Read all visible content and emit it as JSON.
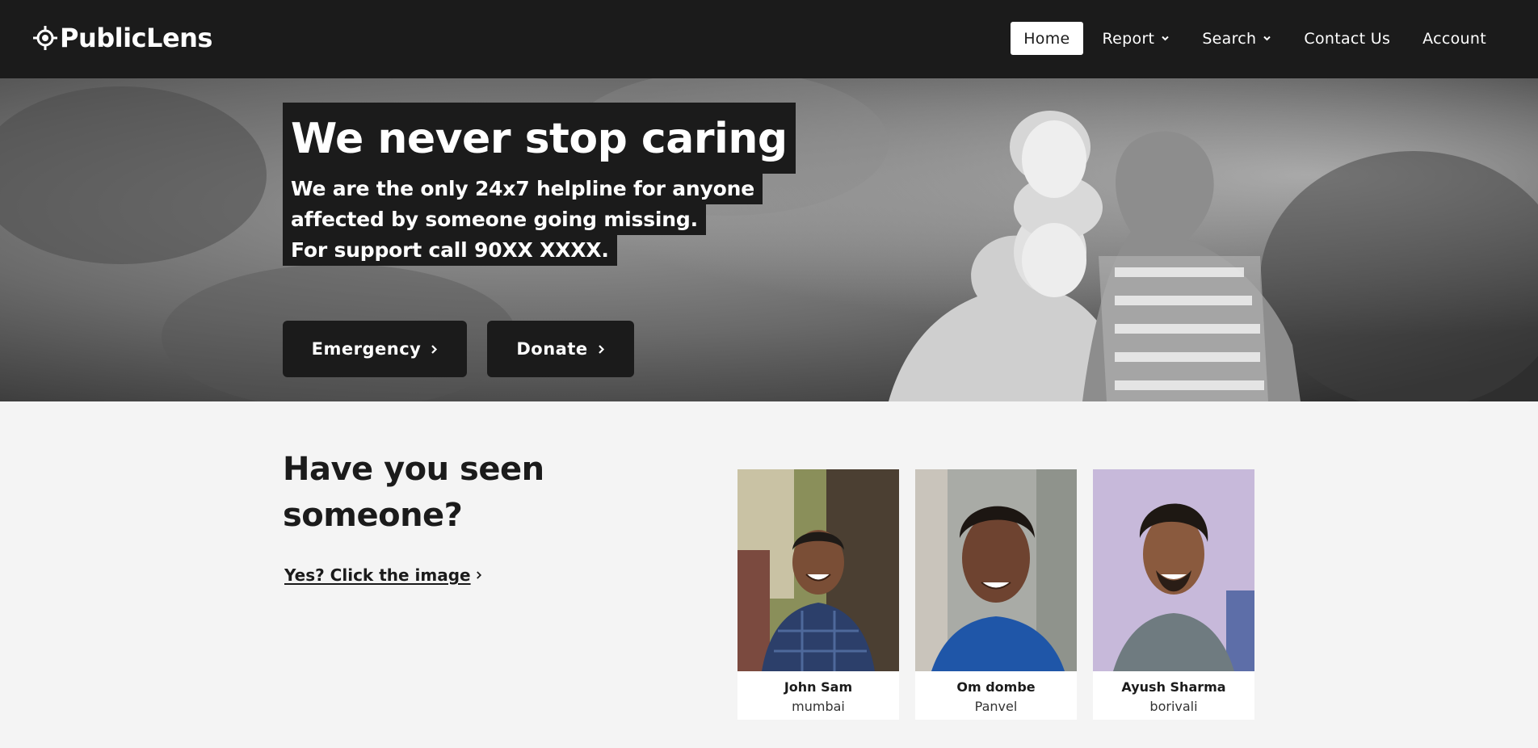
{
  "brand": {
    "name": "PublicLens",
    "icon": "crosshair-target-icon"
  },
  "nav": {
    "items": [
      {
        "label": "Home",
        "active": true,
        "dropdown": false
      },
      {
        "label": "Report",
        "active": false,
        "dropdown": true
      },
      {
        "label": "Search",
        "active": false,
        "dropdown": true
      },
      {
        "label": "Contact Us",
        "active": false,
        "dropdown": false
      },
      {
        "label": "Account",
        "active": false,
        "dropdown": false
      }
    ]
  },
  "hero": {
    "title": "We never stop caring",
    "lines": [
      "We are the only 24x7 helpline for anyone",
      "affected by someone going missing.",
      "For support call 90XX XXXX."
    ],
    "buttons": {
      "emergency": "Emergency",
      "donate": "Donate"
    }
  },
  "seen": {
    "title": "Have you seen someone?",
    "link": "Yes? Click the image"
  },
  "people": [
    {
      "name": "John Sam",
      "location": "mumbai",
      "bg": "#8a8f5a"
    },
    {
      "name": "Om dombe",
      "location": "Panvel",
      "bg": "#a9aba6"
    },
    {
      "name": "Ayush Sharma",
      "location": "borivali",
      "bg": "#c7b9da"
    }
  ],
  "colors": {
    "navbar": "#1b1b1b",
    "page_bg": "#f4f4f4",
    "accent_white": "#ffffff",
    "dark": "#1b1b1b"
  }
}
